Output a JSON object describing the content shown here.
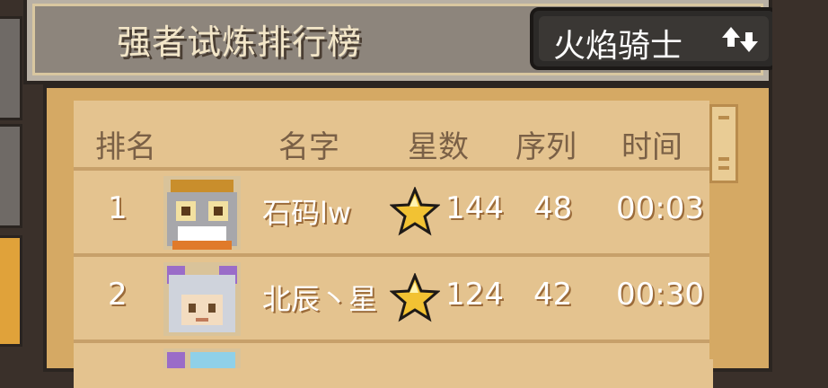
{
  "header": {
    "title": "强者试炼排行榜",
    "hero_name": "火焰骑士"
  },
  "columns": {
    "rank": "排名",
    "name": "名字",
    "stars": "星数",
    "sequence": "序列",
    "time": "时间"
  },
  "rows": [
    {
      "rank": "1",
      "name": "石码lw",
      "stars": "144",
      "sequence": "48",
      "time": "00:03"
    },
    {
      "rank": "2",
      "name": "北辰丶星",
      "stars": "124",
      "sequence": "42",
      "time": "00:30"
    }
  ],
  "icons": {
    "swap": "swap-arrows-icon",
    "star": "star-icon"
  },
  "colors": {
    "board": "#d5a964",
    "board_inner": "#e4c38f",
    "header_text": "#f3e6c8"
  }
}
